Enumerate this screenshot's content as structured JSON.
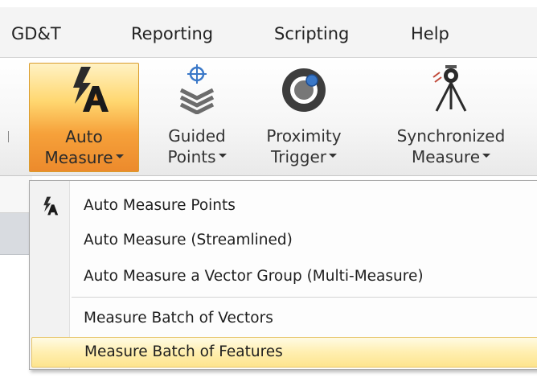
{
  "menubar": {
    "items": [
      "GD&T",
      "Reporting",
      "Scripting",
      "Help"
    ]
  },
  "ribbon": {
    "buttons": [
      {
        "line1": "Auto",
        "line2": "Measure",
        "icon": "auto-measure-icon",
        "active": true
      },
      {
        "line1": "Guided",
        "line2": "Points",
        "icon": "guided-points-icon"
      },
      {
        "line1": "Proximity",
        "line2": "Trigger",
        "icon": "proximity-trigger-icon"
      },
      {
        "line1": "Synchronized",
        "line2": "Measure",
        "icon": "synchronized-measure-icon"
      }
    ]
  },
  "dropdown": {
    "items": [
      {
        "label": "Auto Measure Points",
        "icon": "auto-measure-icon"
      },
      {
        "label": "Auto Measure (Streamlined)"
      },
      {
        "label": "Auto Measure a Vector Group (Multi-Measure)"
      },
      {
        "label": "Measure Batch of Vectors"
      },
      {
        "label": "Measure Batch of Features",
        "highlighted": true
      }
    ]
  },
  "colors": {
    "active_button": "#f6a13a",
    "hover_item": "#ffefb0",
    "icon_dark": "#2b2b2b",
    "icon_blue": "#3a78c8"
  }
}
